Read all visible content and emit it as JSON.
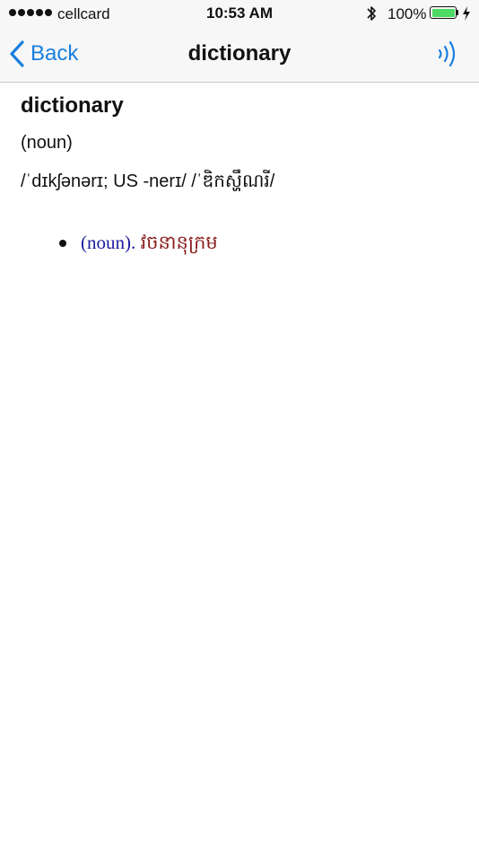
{
  "status_bar": {
    "carrier": "cellcard",
    "time": "10:53 AM",
    "battery_percent": "100%",
    "signal_bars": 5,
    "battery_level": 1.0
  },
  "nav": {
    "back_label": "Back",
    "title": "dictionary"
  },
  "entry": {
    "word": "dictionary",
    "part_of_speech": "(noun)",
    "pronunciation": "/ˈdɪkʃənərɪ; US -nerɪ/ /ˈឌិកស្ហឹណរី/",
    "definitions": [
      {
        "pos": "(noun).",
        "text": " វចនានុក្រម"
      }
    ]
  },
  "colors": {
    "accent": "#1a7fe0",
    "definition_pos": "#1c1c9e",
    "definition_text": "#8a1c1c",
    "battery_fill": "#4cd964"
  },
  "icons": {
    "back": "chevron-left-icon",
    "speaker": "sound-waves-icon",
    "bluetooth": "bluetooth-icon",
    "battery": "battery-icon",
    "charging": "lightning-icon"
  }
}
